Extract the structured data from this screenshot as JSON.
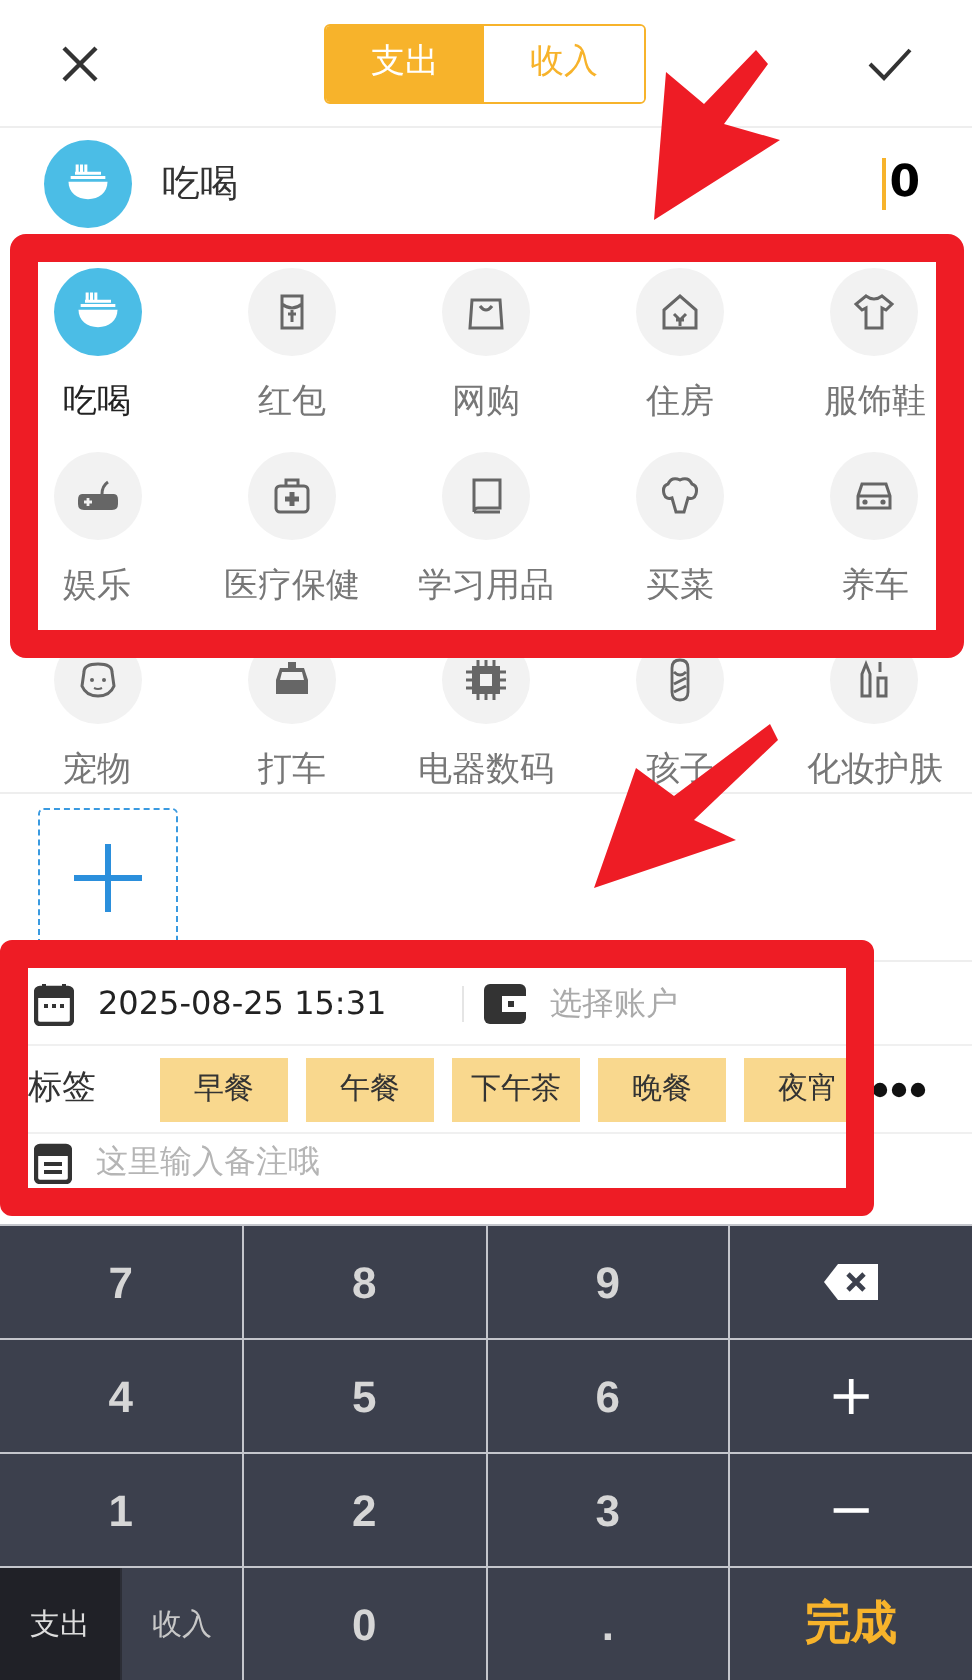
{
  "header": {
    "tabs": [
      {
        "label": "支出",
        "selected": true
      },
      {
        "label": "收入",
        "selected": false
      }
    ]
  },
  "current": {
    "label": "吃喝",
    "amount": "0"
  },
  "categories": [
    {
      "label": "吃喝",
      "selected": true
    },
    {
      "label": "红包",
      "selected": false
    },
    {
      "label": "网购",
      "selected": false
    },
    {
      "label": "住房",
      "selected": false
    },
    {
      "label": "服饰鞋",
      "selected": false
    },
    {
      "label": "娱乐",
      "selected": false
    },
    {
      "label": "医疗保健",
      "selected": false
    },
    {
      "label": "学习用品",
      "selected": false
    },
    {
      "label": "买菜",
      "selected": false
    },
    {
      "label": "养车",
      "selected": false
    },
    {
      "label": "宠物",
      "selected": false
    },
    {
      "label": "打车",
      "selected": false
    },
    {
      "label": "电器数码",
      "selected": false
    },
    {
      "label": "孩子",
      "selected": false
    },
    {
      "label": "化妆护肤",
      "selected": false
    }
  ],
  "details": {
    "datetime": "2025-08-25 15:31",
    "account_placeholder": "选择账户",
    "tags_label": "标签",
    "tags": [
      "早餐",
      "午餐",
      "下午茶",
      "晚餐",
      "夜宵"
    ],
    "note_placeholder": "这里输入备注哦"
  },
  "keypad": [
    {
      "kind": "digit",
      "label": "7"
    },
    {
      "kind": "digit",
      "label": "8"
    },
    {
      "kind": "digit",
      "label": "9"
    },
    {
      "kind": "backspace"
    },
    {
      "kind": "digit",
      "label": "4"
    },
    {
      "kind": "digit",
      "label": "5"
    },
    {
      "kind": "digit",
      "label": "6"
    },
    {
      "kind": "operator",
      "label": "+"
    },
    {
      "kind": "digit",
      "label": "1"
    },
    {
      "kind": "digit",
      "label": "2"
    },
    {
      "kind": "digit",
      "label": "3"
    },
    {
      "kind": "operator",
      "label": "−"
    },
    {
      "kind": "toggle",
      "options": [
        {
          "label": "支出",
          "selected": true
        },
        {
          "label": "收入",
          "selected": false
        }
      ]
    },
    {
      "kind": "digit",
      "label": "0"
    },
    {
      "kind": "digit",
      "label": "."
    },
    {
      "kind": "done",
      "label": "完成"
    }
  ]
}
